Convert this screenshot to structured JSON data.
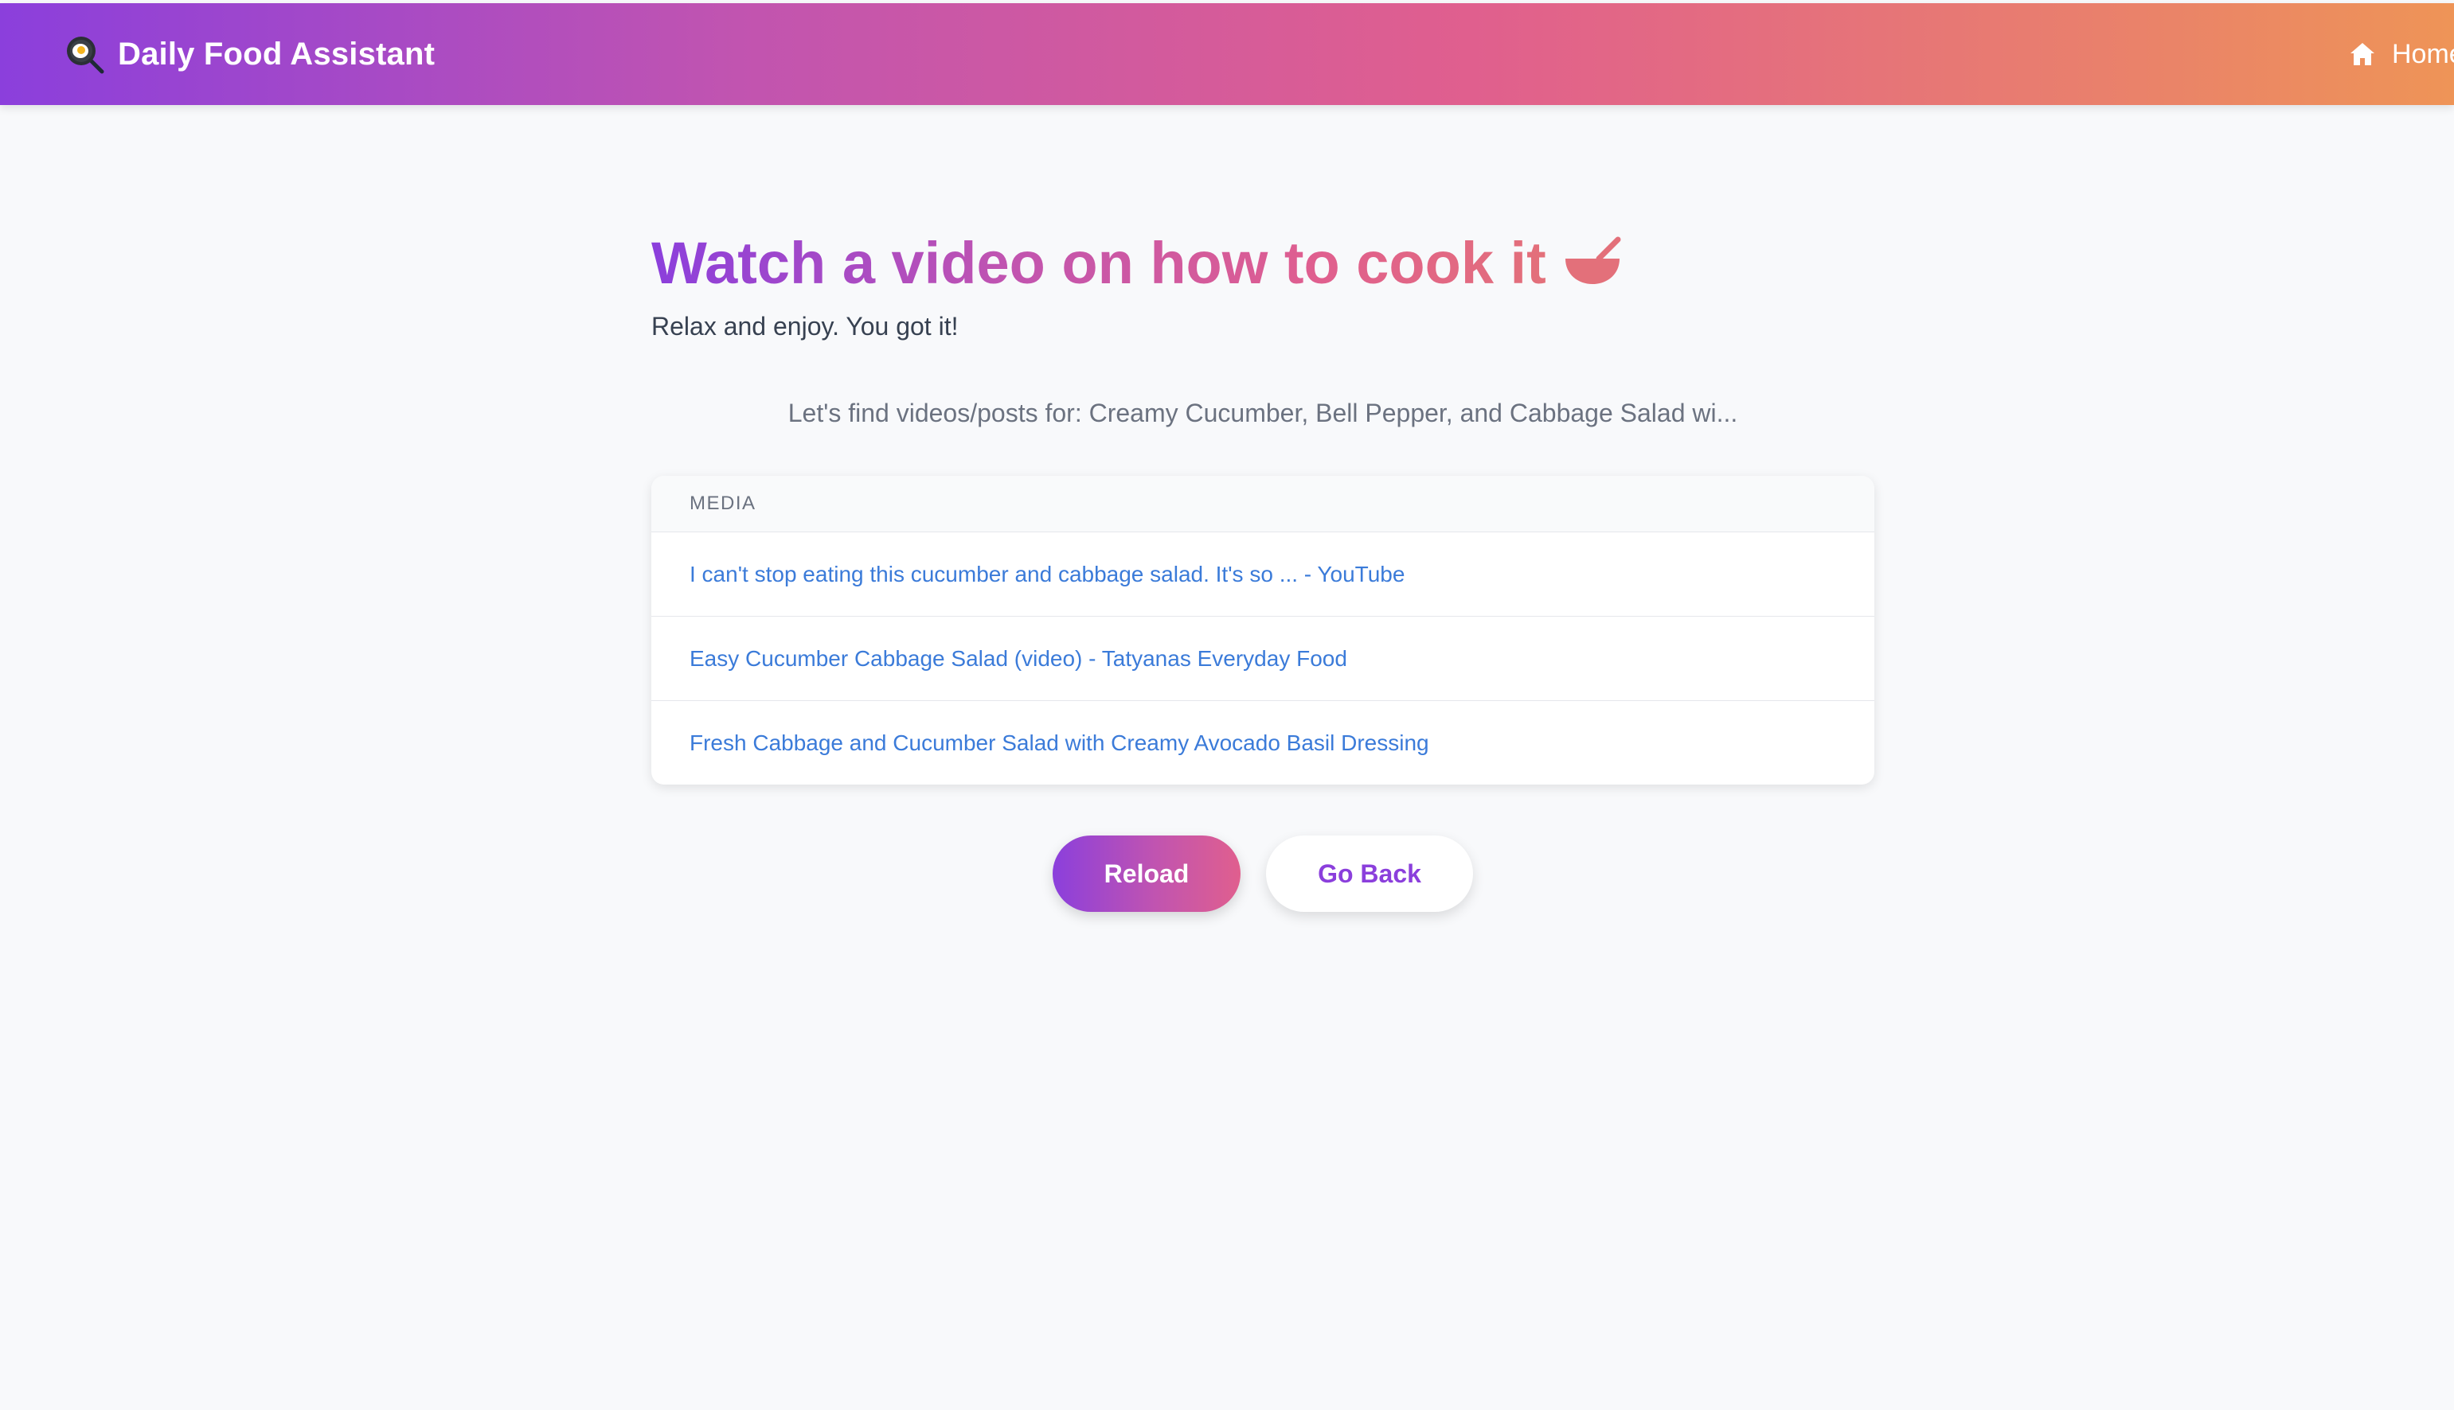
{
  "navbar": {
    "brand_icon": "frying-pan-egg-icon",
    "title": "Daily Food Assistant",
    "home_icon": "home-icon",
    "home_label": "Home",
    "gradient_colors": [
      "#8b3fdc",
      "#c154b0",
      "#e05f8e",
      "#e97f6d",
      "#ee9457"
    ]
  },
  "main": {
    "headline": "Watch a video on how to cook it",
    "headline_icon": "bowl-with-spoon-icon",
    "subtitle": "Relax and enjoy. You got it!",
    "search_text": "Let's find videos/posts for: Creamy Cucumber, Bell Pepper, and Cabbage Salad wi..."
  },
  "media": {
    "header": "MEDIA",
    "items": [
      {
        "title": "I can't stop eating this cucumber and cabbage salad. It's so ... - YouTube"
      },
      {
        "title": "Easy Cucumber Cabbage Salad (video) - Tatyanas Everyday Food"
      },
      {
        "title": "Fresh Cabbage and Cucumber Salad with Creamy Avocado Basil Dressing"
      }
    ],
    "link_color": "#3b7bd9"
  },
  "actions": {
    "reload_label": "Reload",
    "back_label": "Go Back",
    "accent_color": "#8b3fdc"
  }
}
